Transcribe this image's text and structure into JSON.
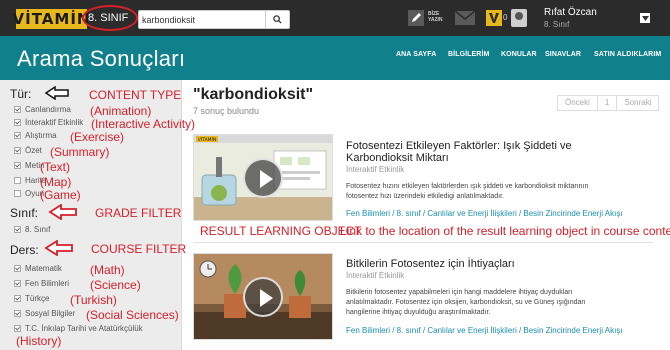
{
  "topbar": {
    "logo": "VİTAMİN",
    "grade": "8. SINIF",
    "search_value": "karbondioksit",
    "write_label_1": "BİZE",
    "write_label_2": "YAZIN",
    "points_count": "0",
    "user_name": "Rıfat Özcan",
    "user_grade": "8. Sınıf"
  },
  "header": {
    "title": "Arama Sonuçları",
    "nav": [
      "ANA SAYFA",
      "BİLGİLERİM",
      "KONULAR",
      "SINAVLAR",
      "SATIN ALDIKLARIM"
    ]
  },
  "sidebar": {
    "type_title": "Tür:",
    "types": [
      {
        "label": "Canlandırma",
        "checked": true
      },
      {
        "label": "İnteraktif Etkinlik",
        "checked": true
      },
      {
        "label": "Alıştırma",
        "checked": true
      },
      {
        "label": "Özet",
        "checked": true
      },
      {
        "label": "Metin",
        "checked": true
      },
      {
        "label": "Harita",
        "checked": false
      },
      {
        "label": "Oyun",
        "checked": false
      }
    ],
    "grade_title": "Sınıf:",
    "grades": [
      {
        "label": "8. Sınıf",
        "checked": true
      }
    ],
    "course_title": "Ders:",
    "courses": [
      {
        "label": "Matematik",
        "checked": true
      },
      {
        "label": "Fen Bilimleri",
        "checked": true
      },
      {
        "label": "Türkçe",
        "checked": true
      },
      {
        "label": "Sosyal Bilgiler",
        "checked": true
      },
      {
        "label": "T.C. İnkılap Tarihi ve Atatürkçülük",
        "checked": true
      }
    ]
  },
  "annotations": {
    "content_type": "CONTENT TYPE",
    "type_notes": [
      "(Animation)",
      "(Interactive Activity)",
      "(Exercise)",
      "(Summary)",
      "(Text)",
      "(Map)",
      "(Game)"
    ],
    "grade_filter": "GRADE FILTER",
    "course_filter": "COURSE FILTER",
    "course_notes": [
      "(Math)",
      "(Science)",
      "(Turkish)",
      "(Social Sciences)",
      "(History)"
    ],
    "result_object": "RESULT LEARNING OBJECT",
    "link_note": "Link to the location of the result learning object in course content"
  },
  "main": {
    "query": "\"karbondioksit\"",
    "count": "7 sonuç bulundu",
    "pager_prev": "Önceki",
    "pager_page": "1",
    "pager_next": "Sonraki",
    "results": [
      {
        "title_line1": "Fotosentezi Etkileyen Faktörler: Işık Şiddeti ve",
        "title_line2": "Karbondioksit Miktarı",
        "type": "İnteraktif Etkinlik",
        "desc_line1": "Fotosentez hızını etkileyen faktörlerden ışık şiddeti ve karbondioksit miktarının",
        "desc_line2": "fotosentez hızı üzerindeki etkiledigi anlatılmaktadır.",
        "path": "Fen Bilimleri / 8. sınıf / Canlılar ve Enerji İlişkileri / Besin Zincirinde Enerji Akışı",
        "thumb_label": "VİTAMİN"
      },
      {
        "title_line1": "Bitkilerin Fotosentez için İhtiyaçları",
        "type": "İnteraktif Etkinlik",
        "desc_line1": "Bitkilerin fotosentez yapabilmeleri için hangi maddelere ihtiyaç duydukları",
        "desc_line2": "anlatılmaktadır. Fotosentez için oksijen, karbondioksit, su ve Güneş ışığından",
        "desc_line3": "hangilerine ihtiyaç duyulduğu araştırılmaktadır.",
        "path": "Fen Bilimleri / 8. sınıf / Canlılar ve Enerji İlişkileri / Besin Zincirinde Enerji Akışı"
      }
    ]
  },
  "colors": {
    "topbar": "#2b2b2b",
    "header": "#10808d",
    "logo": "#e7b81c",
    "annotation": "#d4202a",
    "link": "#1a8eae"
  }
}
